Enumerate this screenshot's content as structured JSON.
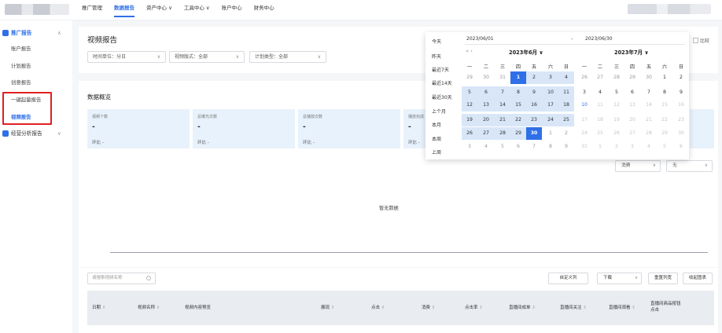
{
  "topnav": {
    "items": [
      "推广管理",
      "数据报告",
      "资产中心 ∨",
      "工具中心 ∨",
      "账户中心",
      "财务中心"
    ],
    "active": "数据报告"
  },
  "sidebar": {
    "group1": {
      "label": "推广报告",
      "chevron": "∧"
    },
    "items": [
      "账户报告",
      "计划报告",
      "创意报告",
      "一键起量报告",
      "视频报告"
    ],
    "group2": {
      "label": "经营分析报告",
      "chevron": "∨"
    },
    "active": "视频报告"
  },
  "page": {
    "title": "视频报告",
    "filters": {
      "time_unit": "时间单位：分日",
      "video_format": "视频版式：全部",
      "plan_type": "计划类型：全部"
    },
    "overview_title": "数据概览",
    "cards": [
      {
        "title": "视频个数",
        "value": "-",
        "ratio": "环比 -"
      },
      {
        "title": "总曝光次数",
        "value": "-",
        "ratio": "环比 -"
      },
      {
        "title": "总播放次数",
        "value": "-",
        "ratio": "环比 -"
      },
      {
        "title": "播放完成",
        "value": "-",
        "ratio": "环比 -"
      }
    ],
    "chart_selects": {
      "metric": "消费",
      "compare": "无"
    },
    "no_data": "暂无数据",
    "search_placeholder": "请搜索视频名称",
    "buttons": {
      "custom_columns": "自定义列",
      "download": "下载",
      "reset_columns": "重置列宽",
      "collapse_chart": "收起图表"
    },
    "table_columns": [
      "日期",
      "视频名称",
      "视频内容预览",
      "展现",
      "点击",
      "消费",
      "点击率",
      "直播间成单",
      "直播间关注",
      "直播间观看",
      "直播间商品按钮",
      "点击"
    ]
  },
  "datepicker": {
    "shortcuts": [
      "今天",
      "昨天",
      "最近7天",
      "最近14天",
      "最近30天",
      "上个月",
      "本月",
      "本周",
      "上周"
    ],
    "start": "2023/06/01",
    "sep": "-",
    "end": "2023/06/30",
    "prev_nav": "« ‹",
    "left_month": "2023年6月 ∨",
    "right_month": "2023年7月 ∨",
    "weekdays": [
      "一",
      "二",
      "三",
      "四",
      "五",
      "六",
      "日"
    ],
    "june": [
      [
        "29",
        "30",
        "31",
        "1",
        "2",
        "3",
        "4"
      ],
      [
        "5",
        "6",
        "7",
        "8",
        "9",
        "10",
        "11"
      ],
      [
        "12",
        "13",
        "14",
        "15",
        "16",
        "17",
        "18"
      ],
      [
        "19",
        "20",
        "21",
        "22",
        "23",
        "24",
        "25"
      ],
      [
        "26",
        "27",
        "28",
        "29",
        "30",
        "1",
        "2"
      ],
      [
        "3",
        "4",
        "5",
        "6",
        "7",
        "8",
        "9"
      ]
    ],
    "july": [
      [
        "26",
        "27",
        "28",
        "29",
        "30",
        "1",
        "2"
      ],
      [
        "3",
        "4",
        "5",
        "6",
        "7",
        "8",
        "9"
      ],
      [
        "10",
        "11",
        "12",
        "13",
        "14",
        "15",
        "16"
      ],
      [
        "17",
        "18",
        "19",
        "20",
        "21",
        "22",
        "23"
      ],
      [
        "24",
        "25",
        "26",
        "27",
        "28",
        "29",
        "30"
      ],
      [
        "31",
        "1",
        "2",
        "3",
        "4",
        "5",
        "6"
      ]
    ],
    "compare_label": "比较",
    "colors": {
      "accent": "#2f6fe8",
      "range_bg": "#d8e6f8"
    }
  }
}
